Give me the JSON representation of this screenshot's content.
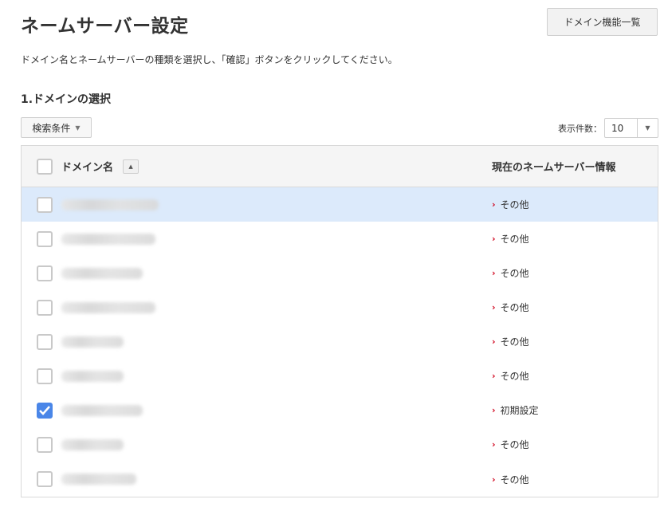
{
  "header": {
    "title": "ネームサーバー設定",
    "domain_list_button": "ドメイン機能一覧"
  },
  "description": "ドメイン名とネームサーバーの種類を選択し、「確認」ボタンをクリックしてください。",
  "section": {
    "title": "1.ドメインの選択"
  },
  "filter": {
    "label": "検索条件",
    "caret_icon": "caret-down-icon"
  },
  "pagination": {
    "label": "表示件数：",
    "value": "10",
    "arrow_icon": "caret-down-icon"
  },
  "table": {
    "columns": {
      "domain": "ドメイン名",
      "nameserver": "現在のネームサーバー情報"
    },
    "sort_icon": "sort-up-icon",
    "accent_color": "#4a86e8",
    "selected_row_color": "#dceafb",
    "link_arrow_color": "#d0021b",
    "rows": [
      {
        "checked": false,
        "nameserver": "その他"
      },
      {
        "checked": false,
        "nameserver": "その他"
      },
      {
        "checked": false,
        "nameserver": "その他"
      },
      {
        "checked": false,
        "nameserver": "その他"
      },
      {
        "checked": false,
        "nameserver": "その他"
      },
      {
        "checked": false,
        "nameserver": "その他"
      },
      {
        "checked": true,
        "nameserver": "初期設定"
      },
      {
        "checked": false,
        "nameserver": "その他"
      },
      {
        "checked": false,
        "nameserver": "その他"
      }
    ]
  }
}
